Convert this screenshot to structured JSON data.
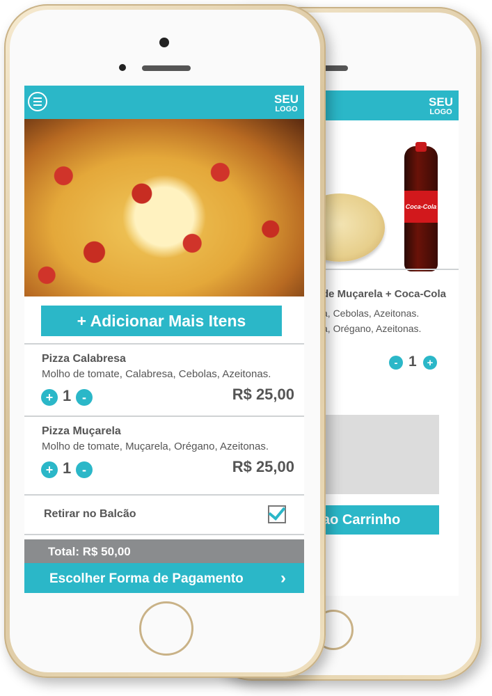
{
  "brand": {
    "logo_line1": "SEU",
    "logo_line2": "LOGO"
  },
  "front": {
    "add_button": "+ Adicionar Mais Itens",
    "items": [
      {
        "name": "Pizza Calabresa",
        "description": "Molho de tomate, Calabresa, Cebolas, Azeitonas.",
        "quantity": "1",
        "price": "R$ 25,00"
      },
      {
        "name": "Pizza Muçarela",
        "description": "Molho de tomate, Muçarela, Orégano, Azeitonas.",
        "quantity": "1",
        "price": "R$ 25,00"
      }
    ],
    "pickup_label": "Retirar no Balcão",
    "total": "Total: R$ 50,00",
    "payment_button": "Escolher Forma de Pagamento",
    "plus": "+",
    "minus": "-",
    "chevron": "›"
  },
  "back": {
    "product_title": "de Muçarela + Coca-Cola",
    "desc_line1": "a, Cebolas, Azeitonas.",
    "desc_line2": "a, Orégano, Azeitonas.",
    "quantity": "1",
    "cart_button": "ao Carrinho",
    "coke_label": "Coca-Cola"
  },
  "colors": {
    "accent": "#2bb7c8",
    "total_bar": "#8a8c8e",
    "text": "#555555"
  }
}
